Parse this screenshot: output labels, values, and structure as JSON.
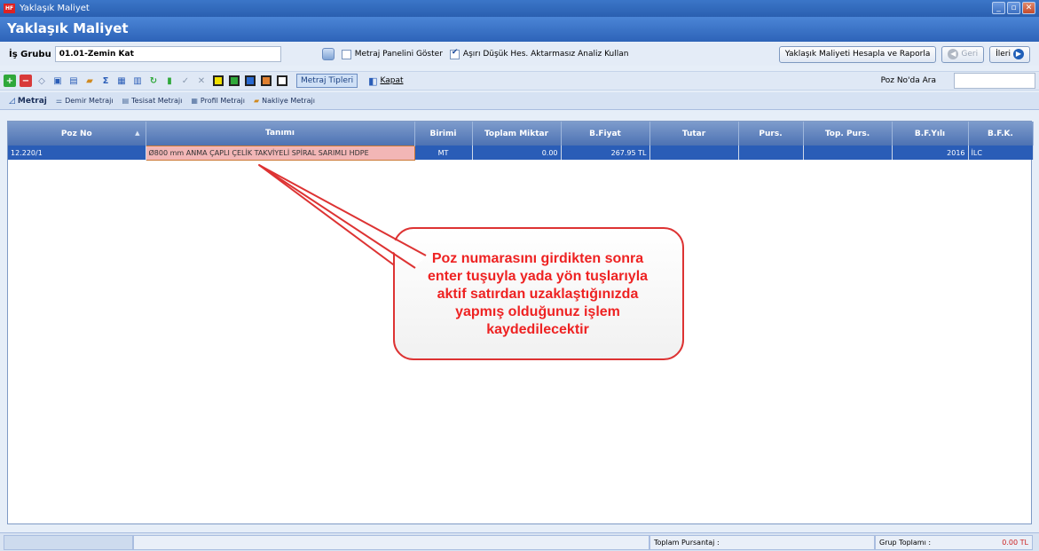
{
  "window": {
    "title": "Yaklaşık Maliyet",
    "app_icon": "HF"
  },
  "header": {
    "title": "Yaklaşık Maliyet"
  },
  "filter": {
    "group_label": "İş Grubu",
    "group_value": "01.01-Zemin Kat",
    "show_panel_label": "Metraj Panelini Göster",
    "show_panel_checked": false,
    "analysis_label": "Aşırı Düşük Hes. Aktarmasız Analiz Kullan",
    "analysis_checked": true,
    "calc_button": "Yaklaşık Maliyeti Hesapla ve Raporla",
    "back_button": "Geri",
    "next_button": "İleri"
  },
  "toolbar": {
    "metraj_types": "Metraj Tipleri",
    "close": "Kapat",
    "search_label": "Poz No'da Ara",
    "search_value": "",
    "colors": [
      "#f0e000",
      "#2fa83a",
      "#2a6ad0",
      "#e08030",
      "#ffffff"
    ]
  },
  "tabs": [
    "Metraj",
    "Demir Metrajı",
    "Tesisat Metrajı",
    "Profil Metrajı",
    "Nakliye Metrajı"
  ],
  "table": {
    "columns": [
      "Poz No",
      "Tanımı",
      "Birimi",
      "Toplam Miktar",
      "B.Fiyat",
      "Tutar",
      "Purs.",
      "Top. Purs.",
      "B.F.Yılı",
      "B.F.K."
    ],
    "rows": [
      {
        "poz_no": "12.220/1",
        "tanim": "Ø800 mm ANMA ÇAPLI ÇELİK TAKVİYELİ SPİRAL SARIMLI HDPE",
        "birim": "MT",
        "miktar": "0.00",
        "fiyat": "267.95 TL",
        "tutar": "",
        "purs": "",
        "top_purs": "",
        "yil": "2016",
        "bfk": "İLC"
      }
    ]
  },
  "callout": {
    "text": "Poz numarasını girdikten sonra enter tuşuyla yada yön tuşlarıyla aktif satırdan uzaklaştığınızda yapmış olduğunuz işlem kaydedilecektir"
  },
  "status": {
    "total_pursantaj_label": "Toplam Pursantaj :",
    "group_total_label": "Grup Toplamı :",
    "group_total_value": "0.00 TL"
  }
}
